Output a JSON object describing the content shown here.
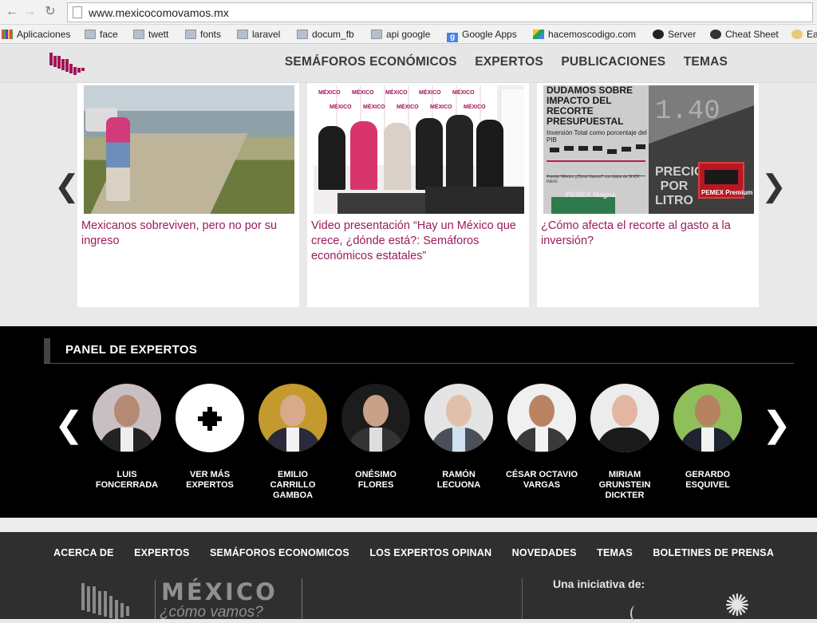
{
  "browser": {
    "url": "www.mexicocomovamos.mx",
    "bookmarks": [
      {
        "label": "Aplicaciones",
        "icon": "apps-icon"
      },
      {
        "label": "face",
        "icon": "folder-icon"
      },
      {
        "label": "twett",
        "icon": "folder-icon"
      },
      {
        "label": "fonts",
        "icon": "folder-icon"
      },
      {
        "label": "laravel",
        "icon": "folder-icon"
      },
      {
        "label": "docum_fb",
        "icon": "folder-icon"
      },
      {
        "label": "api google",
        "icon": "folder-icon"
      },
      {
        "label": "Google Apps",
        "icon": "google-icon"
      },
      {
        "label": "hacemoscodigo.com",
        "icon": "drive-icon"
      },
      {
        "label": "Server",
        "icon": "github-icon"
      },
      {
        "label": "Cheat Sheet",
        "icon": "cheatsheet-icon"
      },
      {
        "label": "Ea",
        "icon": "egg-icon"
      }
    ]
  },
  "header": {
    "nav": [
      "SEMÁFOROS ECONÓMICOS",
      "EXPERTOS",
      "PUBLICACIONES",
      "TEMAS"
    ]
  },
  "carousel": {
    "cards": [
      {
        "title": "Mexicanos sobreviven, pero no por su ingreso"
      },
      {
        "title": "Video presentación “Hay un México que crece, ¿dónde está?: Semáforos económicos estatales”"
      },
      {
        "title": "¿Cómo afecta el recorte al gasto a la inversión?"
      }
    ],
    "card3_image": {
      "headline": "DUDAMOS SOBRE IMPACTO DEL RECORTE PRESUPUESTAL",
      "subtitle": "Inversión Total como porcentaje del PIB",
      "footnote": "Fuente: México ¿Cómo Vamos? con datos de SHCP, INEGI",
      "precio": "PRECIO POR LITRO",
      "brand1": "PEMEX Magna",
      "brand2": "PEMEX Premium"
    },
    "card2_image": {
      "backdrop_text": "MÉXICO"
    }
  },
  "panel": {
    "title": "PANEL DE EXPERTOS",
    "experts": [
      {
        "name": "LUIS FONCERRADA"
      },
      {
        "name": "VER MÁS EXPERTOS"
      },
      {
        "name": "EMILIO CARRILLO GAMBOA"
      },
      {
        "name": "ONÉSIMO FLORES"
      },
      {
        "name": "RAMÓN LECUONA"
      },
      {
        "name": "CÉSAR OCTAVIO VARGAS"
      },
      {
        "name": "MIRIAM GRUNSTEIN DICKTER"
      },
      {
        "name": "GERARDO ESQUIVEL"
      }
    ]
  },
  "footer": {
    "nav": [
      "ACERCA DE",
      "EXPERTOS",
      "SEMÁFOROS ECONOMICOS",
      "LOS EXPERTOS OPINAN",
      "NOVEDADES",
      "TEMAS",
      "BOLETINES DE PRENSA"
    ],
    "logo_main": "MÉXICO",
    "logo_sub": "¿cómo vamos?",
    "initiative_label": "Una iniciativa de:"
  },
  "colors": {
    "accent": "#9c1a5b",
    "panel_bg": "#000000",
    "footer_bg": "#2f2f2f"
  }
}
